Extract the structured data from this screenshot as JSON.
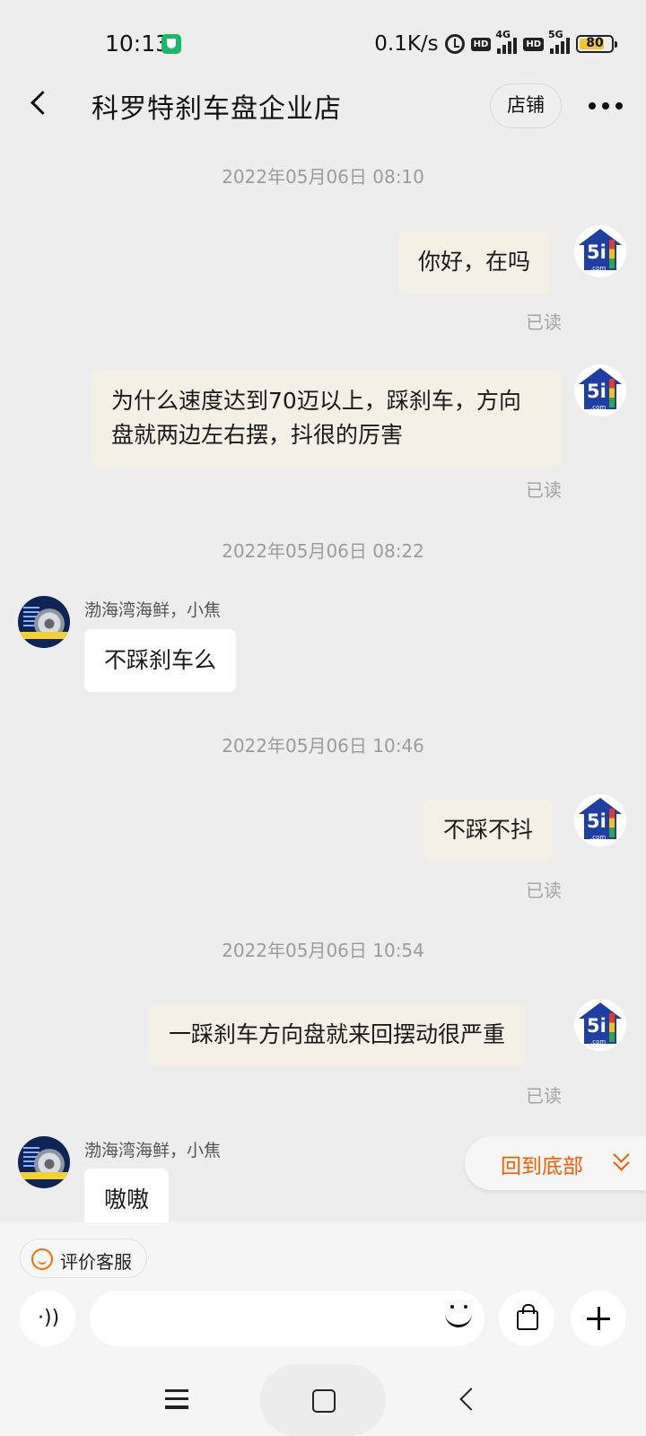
{
  "status_bar": {
    "time": "10:13",
    "speed": "0.1K/s",
    "hd1": "HD",
    "net1": "4G",
    "hd2": "HD",
    "net2": "5G",
    "battery": "80",
    "battery_level": 0.8,
    "shield_color": "#19b86b",
    "battery_color": "#f0c52e"
  },
  "header": {
    "title": "科罗特刹车盘企业店",
    "store_button": "店铺",
    "back_icon": "chevron-left-icon",
    "more_icon": "more-dots-icon"
  },
  "chat": {
    "timestamps": [
      "2022年05月06日 08:10",
      "2022年05月06日 08:22",
      "2022年05月06日 10:46",
      "2022年05月06日 10:54"
    ],
    "messages": [
      {
        "from": "me",
        "text": "你好，在吗",
        "status": "已读"
      },
      {
        "from": "me",
        "text": "为什么速度达到70迈以上，踩刹车，方向盘就两边左右摆，抖很的厉害",
        "status": "已读"
      },
      {
        "from": "them",
        "sender": "渤海湾海鲜，小焦",
        "text": "不踩刹车么"
      },
      {
        "from": "me",
        "text": "不踩不抖",
        "status": "已读"
      },
      {
        "from": "me",
        "text": "一踩刹车方向盘就来回摆动很严重",
        "status": "已读"
      },
      {
        "from": "them",
        "sender": "渤海湾海鲜，小焦",
        "text": "嗷嗷"
      }
    ],
    "my_avatar_text": "5i",
    "my_avatar_sub": ".com"
  },
  "float_button": {
    "label": "回到底部",
    "icon": "double-chevron-down-icon",
    "color": "#ff5a00"
  },
  "bottom_bar": {
    "rate_button": "评价客服",
    "voice_icon": "voice-icon",
    "emoji_icon": "emoji-icon",
    "bag_icon": "shopping-bag-icon",
    "plus_icon": "plus-icon"
  },
  "nav_bar": {
    "menu_icon": "menu-icon",
    "home_icon": "home-icon",
    "back_icon": "back-icon"
  },
  "colors": {
    "outgoing_bubble": "#f5f0e6",
    "incoming_bubble": "#ffffff",
    "background": "#ededed"
  }
}
